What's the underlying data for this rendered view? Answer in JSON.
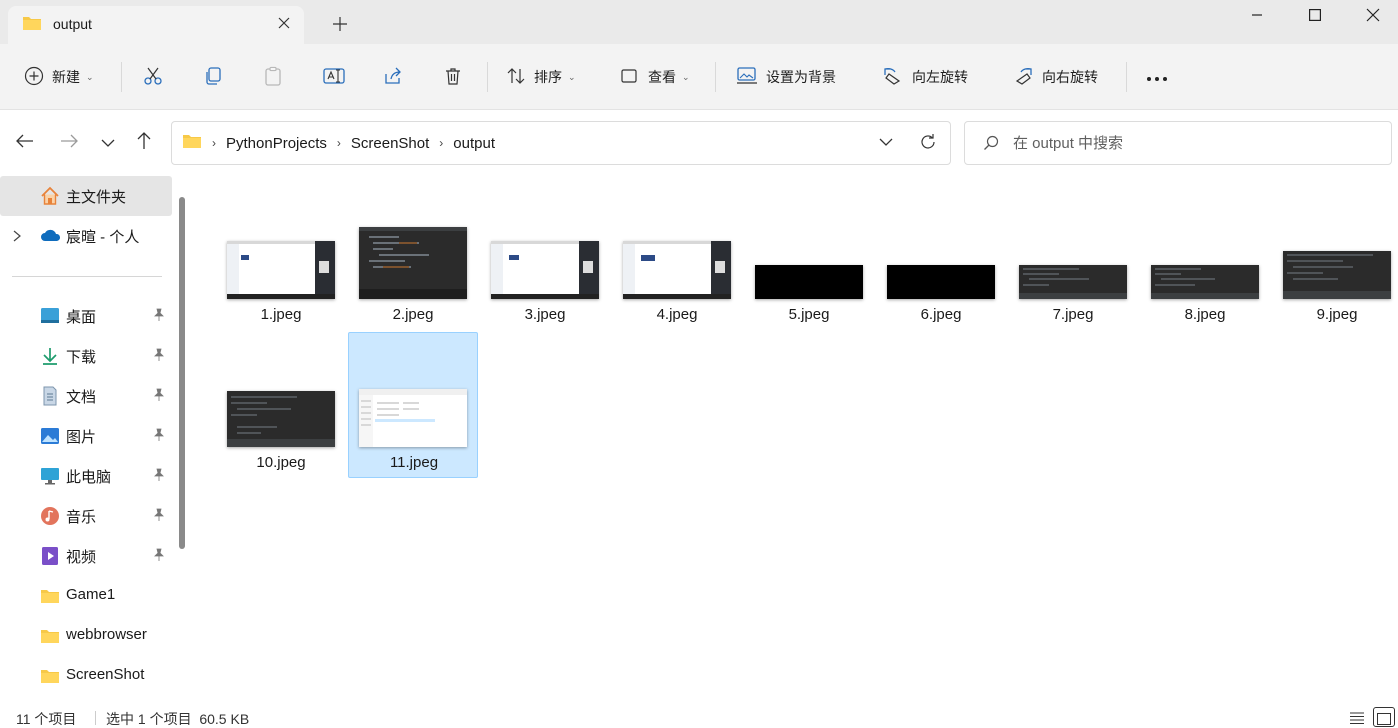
{
  "tab": {
    "title": "output"
  },
  "toolbar": {
    "new_label": "新建",
    "sort_label": "排序",
    "view_label": "查看",
    "set_background_label": "设置为背景",
    "rotate_left_label": "向左旋转",
    "rotate_right_label": "向右旋转"
  },
  "address": {
    "crumbs": [
      "PythonProjects",
      "ScreenShot",
      "output"
    ]
  },
  "search": {
    "placeholder": "在 output 中搜索"
  },
  "sidebar": {
    "items": [
      {
        "label": "主文件夹",
        "icon": "home-icon"
      },
      {
        "label": "宸暄 - 个人",
        "icon": "onedrive-cloud-icon"
      },
      {
        "label": "桌面",
        "icon": "desktop-icon",
        "pinned": true
      },
      {
        "label": "下载",
        "icon": "download-icon",
        "pinned": true
      },
      {
        "label": "文档",
        "icon": "document-icon",
        "pinned": true
      },
      {
        "label": "图片",
        "icon": "pictures-icon",
        "pinned": true
      },
      {
        "label": "此电脑",
        "icon": "computer-icon",
        "pinned": true
      },
      {
        "label": "音乐",
        "icon": "music-icon",
        "pinned": true
      },
      {
        "label": "视频",
        "icon": "video-icon",
        "pinned": true
      },
      {
        "label": "Game1",
        "icon": "folder-icon"
      },
      {
        "label": "webbrowser",
        "icon": "folder-icon"
      },
      {
        "label": "ScreenShot",
        "icon": "folder-icon"
      }
    ]
  },
  "files": [
    {
      "name": "1.jpeg",
      "thumb": "light-desktop"
    },
    {
      "name": "2.jpeg",
      "thumb": "dark-code"
    },
    {
      "name": "3.jpeg",
      "thumb": "light-desktop"
    },
    {
      "name": "4.jpeg",
      "thumb": "light-desktop"
    },
    {
      "name": "5.jpeg",
      "thumb": "black"
    },
    {
      "name": "6.jpeg",
      "thumb": "black"
    },
    {
      "name": "7.jpeg",
      "thumb": "dark-code"
    },
    {
      "name": "8.jpeg",
      "thumb": "dark-code"
    },
    {
      "name": "9.jpeg",
      "thumb": "dark-code"
    },
    {
      "name": "10.jpeg",
      "thumb": "dark-code"
    },
    {
      "name": "11.jpeg",
      "thumb": "explorer",
      "selected": true
    }
  ],
  "status": {
    "item_count": "11 个项目",
    "selection": "选中 1 个项目  60.5 KB"
  },
  "colors": {
    "selection_bg": "#cce8ff",
    "selection_border": "#99d1ff",
    "accent": "#0067c0"
  }
}
